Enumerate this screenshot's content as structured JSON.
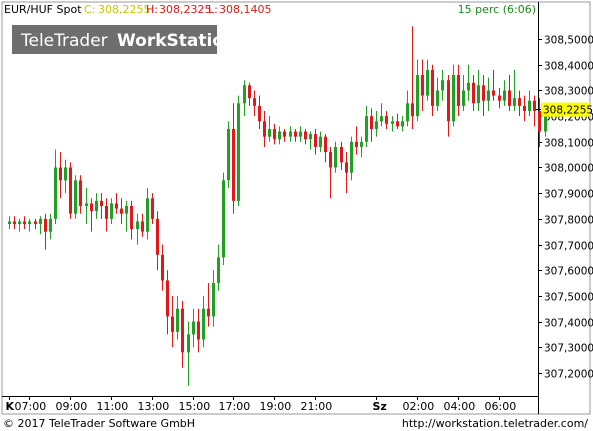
{
  "header": {
    "symbol": "EUR/HUF Spot",
    "close_label": "C:",
    "close_value": "308,2255",
    "high_label": "H:",
    "high_value": "308,2325",
    "low_label": "L:",
    "low_value": "308,1405",
    "interval": "15 perc (6:06)"
  },
  "watermark": {
    "brand": "TeleTrader",
    "product": "WorkStation"
  },
  "footer": {
    "copyright": "© 2017  TeleTrader Software GmbH",
    "url": "http://workstation.teletrader.com/"
  },
  "colors": {
    "up": "#22a022",
    "down": "#e01818",
    "current_price_bg": "#ffff00",
    "close_text": "#c8c800",
    "high_text": "#e01818",
    "low_text": "#e01818",
    "interval_text": "#1a8a1a"
  },
  "chart_data": {
    "type": "candlestick",
    "current_price": 308.2255,
    "current_price_label": "308,2255",
    "ylim": [
      307.11,
      308.59
    ],
    "y_ticks": [
      {
        "value": 307.2,
        "label": "307,2000"
      },
      {
        "value": 307.3,
        "label": "307,3000"
      },
      {
        "value": 307.4,
        "label": "307,4000"
      },
      {
        "value": 307.5,
        "label": "307,5000"
      },
      {
        "value": 307.6,
        "label": "307,6000"
      },
      {
        "value": 307.7,
        "label": "307,7000"
      },
      {
        "value": 307.8,
        "label": "307,8000"
      },
      {
        "value": 307.9,
        "label": "307,9000"
      },
      {
        "value": 308.0,
        "label": "308,0000"
      },
      {
        "value": 308.1,
        "label": "308,1000"
      },
      {
        "value": 308.2,
        "label": "308,2000"
      },
      {
        "value": 308.3,
        "label": "308,3000"
      },
      {
        "value": 308.4,
        "label": "308,4000"
      },
      {
        "value": 308.5,
        "label": "308,5000"
      }
    ],
    "x_ticks": [
      {
        "index": 0,
        "label": "K"
      },
      {
        "index": 4,
        "label": "07:00"
      },
      {
        "index": 12,
        "label": "09:00"
      },
      {
        "index": 20,
        "label": "11:00"
      },
      {
        "index": 28,
        "label": "13:00"
      },
      {
        "index": 36,
        "label": "15:00"
      },
      {
        "index": 44,
        "label": "17:00"
      },
      {
        "index": 52,
        "label": "19:00"
      },
      {
        "index": 60,
        "label": "21:00"
      },
      {
        "index": 72,
        "label": "Sz"
      },
      {
        "index": 80,
        "label": "02:00"
      },
      {
        "index": 88,
        "label": "04:00"
      },
      {
        "index": 96,
        "label": "06:00"
      }
    ],
    "candles": [
      [
        307.78,
        307.81,
        307.76,
        307.79
      ],
      [
        307.79,
        307.81,
        307.76,
        307.78
      ],
      [
        307.78,
        307.8,
        307.75,
        307.79
      ],
      [
        307.79,
        307.81,
        307.76,
        307.78
      ],
      [
        307.78,
        307.8,
        307.75,
        307.79
      ],
      [
        307.79,
        307.8,
        307.76,
        307.78
      ],
      [
        307.78,
        307.81,
        307.74,
        307.8
      ],
      [
        307.8,
        307.82,
        307.68,
        307.75
      ],
      [
        307.75,
        307.82,
        307.72,
        307.8
      ],
      [
        307.8,
        308.07,
        307.78,
        308.0
      ],
      [
        308.0,
        308.06,
        307.88,
        307.95
      ],
      [
        307.95,
        308.03,
        307.9,
        308.0
      ],
      [
        308.0,
        308.02,
        307.8,
        307.82
      ],
      [
        307.82,
        307.97,
        307.8,
        307.95
      ],
      [
        307.95,
        307.97,
        307.82,
        307.85
      ],
      [
        307.85,
        307.92,
        307.78,
        307.86
      ],
      [
        307.86,
        307.88,
        307.75,
        307.83
      ],
      [
        307.83,
        307.9,
        307.8,
        307.87
      ],
      [
        307.87,
        307.9,
        307.8,
        307.85
      ],
      [
        307.85,
        307.88,
        307.75,
        307.8
      ],
      [
        307.8,
        307.88,
        307.78,
        307.86
      ],
      [
        307.86,
        307.9,
        307.82,
        307.84
      ],
      [
        307.84,
        307.88,
        307.78,
        307.82
      ],
      [
        307.82,
        307.87,
        307.75,
        307.85
      ],
      [
        307.85,
        307.87,
        307.72,
        307.76
      ],
      [
        307.76,
        307.82,
        307.7,
        307.79
      ],
      [
        307.79,
        307.82,
        307.73,
        307.75
      ],
      [
        307.75,
        307.92,
        307.72,
        307.88
      ],
      [
        307.88,
        307.9,
        307.78,
        307.8
      ],
      [
        307.8,
        307.83,
        307.6,
        307.66
      ],
      [
        307.66,
        307.7,
        307.52,
        307.56
      ],
      [
        307.56,
        307.6,
        307.35,
        307.42
      ],
      [
        307.42,
        307.5,
        307.3,
        307.36
      ],
      [
        307.36,
        307.5,
        307.33,
        307.45
      ],
      [
        307.45,
        307.48,
        307.22,
        307.28
      ],
      [
        307.28,
        307.4,
        307.15,
        307.35
      ],
      [
        307.35,
        307.45,
        307.3,
        307.4
      ],
      [
        307.4,
        307.45,
        307.28,
        307.33
      ],
      [
        307.33,
        307.5,
        307.3,
        307.45
      ],
      [
        307.45,
        307.55,
        307.38,
        307.42
      ],
      [
        307.42,
        307.6,
        307.38,
        307.55
      ],
      [
        307.55,
        307.7,
        307.52,
        307.65
      ],
      [
        307.65,
        307.98,
        307.62,
        307.95
      ],
      [
        307.95,
        308.18,
        307.92,
        308.15
      ],
      [
        308.15,
        308.25,
        307.82,
        307.87
      ],
      [
        307.87,
        308.28,
        307.85,
        308.25
      ],
      [
        308.25,
        308.34,
        308.2,
        308.32
      ],
      [
        308.32,
        308.33,
        308.24,
        308.27
      ],
      [
        308.27,
        308.3,
        308.2,
        308.24
      ],
      [
        308.24,
        308.28,
        308.15,
        308.18
      ],
      [
        308.18,
        308.22,
        308.08,
        308.12
      ],
      [
        308.12,
        308.2,
        308.1,
        308.15
      ],
      [
        308.15,
        308.17,
        308.09,
        308.11
      ],
      [
        308.11,
        308.16,
        308.09,
        308.14
      ],
      [
        308.14,
        308.15,
        308.1,
        308.12
      ],
      [
        308.12,
        308.16,
        308.1,
        308.14
      ],
      [
        308.14,
        308.15,
        308.1,
        308.12
      ],
      [
        308.12,
        308.16,
        308.1,
        308.14
      ],
      [
        308.14,
        308.15,
        308.09,
        308.11
      ],
      [
        308.11,
        308.14,
        308.07,
        308.13
      ],
      [
        308.13,
        308.15,
        308.05,
        308.08
      ],
      [
        308.08,
        308.14,
        308.06,
        308.12
      ],
      [
        308.12,
        308.13,
        308.02,
        308.06
      ],
      [
        308.06,
        308.08,
        307.88,
        308.0
      ],
      [
        308.0,
        308.1,
        307.98,
        308.08
      ],
      [
        308.08,
        308.1,
        307.99,
        308.02
      ],
      [
        308.02,
        308.06,
        307.9,
        307.98
      ],
      [
        307.98,
        308.12,
        307.95,
        308.1
      ],
      [
        308.1,
        308.16,
        308.05,
        308.08
      ],
      [
        308.08,
        308.12,
        308.04,
        308.1
      ],
      [
        308.1,
        308.24,
        308.08,
        308.2
      ],
      [
        308.2,
        308.23,
        308.1,
        308.15
      ],
      [
        308.15,
        308.22,
        308.12,
        308.18
      ],
      [
        308.18,
        308.25,
        308.16,
        308.2
      ],
      [
        308.2,
        308.22,
        308.15,
        308.17
      ],
      [
        308.17,
        308.2,
        308.14,
        308.18
      ],
      [
        308.18,
        308.21,
        308.15,
        308.16
      ],
      [
        308.16,
        308.2,
        308.14,
        308.18
      ],
      [
        308.18,
        308.3,
        308.16,
        308.25
      ],
      [
        308.25,
        308.55,
        308.15,
        308.2
      ],
      [
        308.2,
        308.42,
        308.18,
        308.36
      ],
      [
        308.36,
        308.42,
        308.22,
        308.28
      ],
      [
        308.28,
        308.42,
        308.26,
        308.38
      ],
      [
        308.38,
        308.4,
        308.2,
        308.24
      ],
      [
        308.24,
        308.35,
        308.22,
        308.3
      ],
      [
        308.3,
        308.38,
        308.26,
        308.34
      ],
      [
        308.34,
        308.36,
        308.12,
        308.18
      ],
      [
        308.18,
        308.4,
        308.16,
        308.36
      ],
      [
        308.36,
        308.4,
        308.2,
        308.24
      ],
      [
        308.24,
        308.36,
        308.22,
        308.3
      ],
      [
        308.3,
        308.4,
        308.26,
        308.33
      ],
      [
        308.33,
        308.36,
        308.22,
        308.25
      ],
      [
        308.25,
        308.38,
        308.22,
        308.32
      ],
      [
        308.32,
        308.36,
        308.2,
        308.26
      ],
      [
        308.26,
        308.35,
        308.22,
        308.3
      ],
      [
        308.3,
        308.38,
        308.26,
        308.28
      ],
      [
        308.28,
        308.31,
        308.23,
        308.26
      ],
      [
        308.26,
        308.34,
        308.24,
        308.3
      ],
      [
        308.3,
        308.36,
        308.22,
        308.24
      ],
      [
        308.24,
        308.38,
        308.22,
        308.27
      ],
      [
        308.27,
        308.3,
        308.2,
        308.24
      ],
      [
        308.24,
        308.28,
        308.18,
        308.22
      ],
      [
        308.22,
        308.3,
        308.2,
        308.26
      ],
      [
        308.26,
        308.28,
        308.16,
        308.22
      ],
      [
        308.22,
        308.27,
        308.08,
        308.14
      ],
      [
        308.14,
        308.25,
        308.12,
        308.2
      ]
    ]
  }
}
